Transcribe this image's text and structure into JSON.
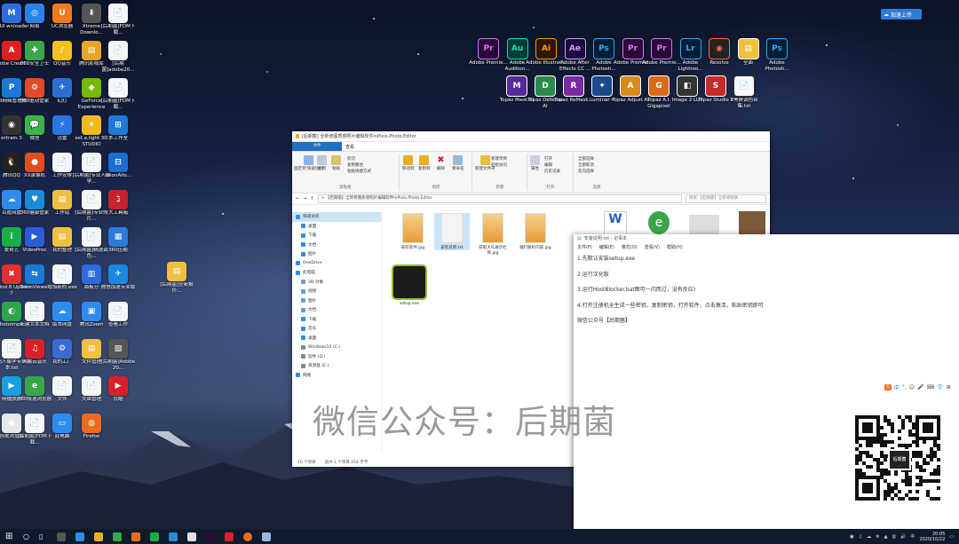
{
  "desktop": {
    "cloud_button": "加速上传",
    "left_icons": [
      {
        "label": "MIUI wnloader",
        "color": "#2d6cdf",
        "glyph": "M"
      },
      {
        "label": "网易",
        "color": "#2b82e6",
        "glyph": "◎"
      },
      {
        "label": "UC浏览器",
        "color": "#f07a1e",
        "glyph": "U"
      },
      {
        "label": "Xtreme Downlo...",
        "color": "#555",
        "glyph": "⬇"
      },
      {
        "label": "[后期菌]FDM下载...",
        "color": "#f6f6f6",
        "glyph": "📄"
      },
      {
        "label": "Adobe Creati...",
        "color": "#e02020",
        "glyph": "A"
      },
      {
        "label": "360安全卫士",
        "color": "#3aa64a",
        "glyph": "✚"
      },
      {
        "label": "QQ音乐",
        "color": "#f3c21c",
        "glyph": "♪"
      },
      {
        "label": "腾讯影视库",
        "color": "#e8a52a",
        "glyph": "▤"
      },
      {
        "label": "[后期菌]adobe20...",
        "color": "#f6f6f6",
        "glyph": "📄"
      },
      {
        "label": "ad网络管理器",
        "color": "#1a78d6",
        "glyph": "P"
      },
      {
        "label": "360驱动管家",
        "color": "#e24a2a",
        "glyph": "⚙"
      },
      {
        "label": "幻灯",
        "color": "#2b6fd0",
        "glyph": "✈"
      },
      {
        "label": "GeForce Experience",
        "color": "#76b900",
        "glyph": "◆"
      },
      {
        "label": "[后期菌]FDM下载...",
        "color": "#f6f6f6",
        "glyph": "📄"
      },
      {
        "label": "ertrain 3",
        "color": "#333",
        "glyph": "◉"
      },
      {
        "label": "微信",
        "color": "#3bb54a",
        "glyph": "💬"
      },
      {
        "label": "迅雷",
        "color": "#2a76e0",
        "glyph": "⚡"
      },
      {
        "label": "set.a.light 3D STUDIO",
        "color": "#f0b820",
        "glyph": "☀"
      },
      {
        "label": "本工作室",
        "color": "#1e7ad8",
        "glyph": "⊞"
      },
      {
        "label": "腾讯QQ",
        "color": "#222",
        "glyph": "🐧"
      },
      {
        "label": "XX录像机",
        "color": "#e34d1e",
        "glyph": "●"
      },
      {
        "label": "工作安排",
        "color": "#f6f6f6",
        "glyph": "📄"
      },
      {
        "label": "[后期菌]专业人像学...",
        "color": "#f6f6f6",
        "glyph": "📄"
      },
      {
        "label": "ssionAllo...",
        "color": "#1a6fd0",
        "glyph": "⊟"
      },
      {
        "label": "百度网盘",
        "color": "#2d8cf0",
        "glyph": "☁"
      },
      {
        "label": "360健康管家",
        "color": "#1a8ad8",
        "glyph": "♥"
      },
      {
        "label": "工作站",
        "color": "#f0c040",
        "glyph": "▤"
      },
      {
        "label": "[后期菌]专业照片...",
        "color": "#f6f6f6",
        "glyph": "📄"
      },
      {
        "label": "大工具箱",
        "color": "#c8232c",
        "glyph": "ℷ"
      },
      {
        "label": "爱奇艺",
        "color": "#18b046",
        "glyph": "i"
      },
      {
        "label": "VideoProc",
        "color": "#2d5bd8",
        "glyph": "▶"
      },
      {
        "label": "我的整理",
        "color": "#f0c040",
        "glyph": "▤"
      },
      {
        "label": "[后期菌]精选调色...",
        "color": "#f6f6f6",
        "glyph": "📄"
      },
      {
        "label": "360压缩",
        "color": "#2d7ad8",
        "glyph": "▦"
      },
      {
        "label": "XMind 8 Update 7",
        "color": "#e03030",
        "glyph": "✖"
      },
      {
        "label": "TeamViewer",
        "color": "#1e78d6",
        "glyph": "⇆"
      },
      {
        "label": "增加新的.exe",
        "color": "#f6f6f6",
        "glyph": "📄"
      },
      {
        "label": "面板分",
        "color": "#2d6cdf",
        "glyph": "▥"
      },
      {
        "label": "微信加速专业版",
        "color": "#1a88e0",
        "glyph": "✈"
      },
      {
        "label": "PhotoImpr...",
        "color": "#2aa84a",
        "glyph": "◐"
      },
      {
        "label": "新建文本文档",
        "color": "#f6f6f6",
        "glyph": "📄"
      },
      {
        "label": "版本网盘",
        "color": "#2d8cf0",
        "glyph": "☁"
      },
      {
        "label": "腾讯Zoom",
        "color": "#2d8cf0",
        "glyph": "▣"
      },
      {
        "label": "查看工作",
        "color": "#f6f6f6",
        "glyph": "📄"
      },
      {
        "label": "三码人像学专业版本.txt",
        "color": "#f6f6f6",
        "glyph": "📄"
      },
      {
        "label": "网易云音乐",
        "color": "#d8202a",
        "glyph": "♫"
      },
      {
        "label": "我的工厂",
        "color": "#3a6ad0",
        "glyph": "⚙"
      },
      {
        "label": "文件管理",
        "color": "#f0c040",
        "glyph": "▤"
      },
      {
        "label": "[后期菌]Adobe 20...",
        "color": "#555",
        "glyph": "▧"
      },
      {
        "label": "频播放器",
        "color": "#18a0e0",
        "glyph": "▶"
      },
      {
        "label": "360极速浏览器",
        "color": "#3aa64a",
        "glyph": "e"
      },
      {
        "label": "文件",
        "color": "#f6f6f6",
        "glyph": "📄"
      },
      {
        "label": "文章管理",
        "color": "#f6f6f6",
        "glyph": "📄"
      },
      {
        "label": "优酷",
        "color": "#d8202a",
        "glyph": "▶"
      },
      {
        "label": "谷歌浏览器",
        "color": "#e8e8e8",
        "glyph": "◉"
      },
      {
        "label": "[后期菌]FDM下载...",
        "color": "#f6f6f6",
        "glyph": "📄"
      },
      {
        "label": "此电脑",
        "color": "#2d8cf0",
        "glyph": "▭"
      },
      {
        "label": "Firefox",
        "color": "#f06a1e",
        "glyph": "◍"
      }
    ],
    "mid_icon": {
      "label": "[后期菌]全新报价...",
      "color": "#f0c040"
    },
    "right_icons_row1": [
      {
        "label": "Adobe Premie...",
        "color": "#2a0a3a",
        "accent": "#e070ff",
        "glyph": "Pr"
      },
      {
        "label": "Adobe Audition...",
        "color": "#063b36",
        "accent": "#00e4bb",
        "glyph": "Au"
      },
      {
        "label": "Adobe Illustrat...",
        "color": "#2f1600",
        "accent": "#ff9a00",
        "glyph": "Ai"
      },
      {
        "label": "Adobe After Effects CC ...",
        "color": "#1c0a3e",
        "accent": "#c9a0ff",
        "glyph": "Ae"
      },
      {
        "label": "Adobe Photosh...",
        "color": "#021e36",
        "accent": "#31a8ff",
        "glyph": "Ps"
      },
      {
        "label": "Adobe Premie...",
        "color": "#2a0a3a",
        "accent": "#e070ff",
        "glyph": "Pr"
      },
      {
        "label": "Adobe Premie...",
        "color": "#2a0a3a",
        "accent": "#e070ff",
        "glyph": "Pr"
      },
      {
        "label": "Adobe Lightroo...",
        "color": "#001e36",
        "accent": "#31a8ff",
        "glyph": "Lr"
      },
      {
        "label": "Resolve",
        "color": "#222",
        "accent": "#ff7040",
        "glyph": "◉"
      },
      {
        "label": "全面",
        "color": "#f0c040",
        "accent": "#fff",
        "glyph": "▤"
      },
      {
        "label": "Adobe Photosh...",
        "color": "#021e36",
        "accent": "#31a8ff",
        "glyph": "Ps"
      }
    ],
    "right_icons_row2": [
      {
        "label": "Topaz Mask AI",
        "color": "#5a2a9a",
        "accent": "#fff",
        "glyph": "M"
      },
      {
        "label": "Topaz DeNoise AI",
        "color": "#2a8a4a",
        "accent": "#fff",
        "glyph": "D"
      },
      {
        "label": "Topaz ReMask...",
        "color": "#7a2aa0",
        "accent": "#fff",
        "glyph": "R"
      },
      {
        "label": "Luminar 4",
        "color": "#1a4a8a",
        "accent": "#fff",
        "glyph": "✦"
      },
      {
        "label": "Topaz Adjust AI",
        "color": "#d88a1a",
        "accent": "#fff",
        "glyph": "A"
      },
      {
        "label": "Topaz A.I. Gigapixel",
        "color": "#d86a1a",
        "accent": "#fff",
        "glyph": "G"
      },
      {
        "label": "Image 2 LUT",
        "color": "#333",
        "accent": "#fff",
        "glyph": "◧"
      },
      {
        "label": "Topaz Studio 2",
        "color": "#c82a2a",
        "accent": "#fff",
        "glyph": "S"
      },
      {
        "label": "V黑屏调色合集.txt",
        "color": "#f6f6f6",
        "accent": "#333",
        "glyph": "📄"
      }
    ]
  },
  "explorer": {
    "title": "[后期菌] 全新修图质感照片编辑软件InPixio.Photo.Editor",
    "tabs": [
      "文件",
      "主页",
      "共享",
      "查看"
    ],
    "ribbon": {
      "pin": "固定到'快速访问'",
      "copy": "复制",
      "paste": "粘贴",
      "cut": "剪切",
      "copy_path": "复制路径",
      "paste_shortcut": "粘贴快捷方式",
      "move_to": "移动到",
      "copy_to": "复制到",
      "delete": "删除",
      "rename": "重命名",
      "new_folder": "新建文件夹",
      "new_item": "新建项目",
      "easy_access": "轻松访问",
      "properties": "属性",
      "open": "打开",
      "edit": "编辑",
      "history": "历史记录",
      "select_all": "全部选择",
      "select_none": "全部取消",
      "invert": "反向选择",
      "groups": [
        "剪贴板",
        "组织",
        "新建",
        "打开",
        "选择"
      ]
    },
    "address": "> 【后期菌】全新修图质感照片编辑软件InPixio.Photo.Editor",
    "search_placeholder": "搜索'【后期菌】全新修图质...",
    "nav": [
      "快速访问",
      "桌面",
      "下载",
      "文档",
      "图片",
      "OneDrive",
      "此电脑",
      "3D 对象",
      "视频",
      "图片",
      "文档",
      "下载",
      "音乐",
      "桌面",
      "Windows10 (C:)",
      "软件 (D:)",
      "资源盘 (E:)",
      "网络"
    ],
    "files": [
      {
        "name": "安装软件.jpg",
        "kind": "img"
      },
      {
        "name": "安装说明.txt",
        "kind": "txt"
      },
      {
        "name": "获取大礼展示栏目.jpg",
        "kind": "img"
      },
      {
        "name": "趣打解析内容.jpg",
        "kind": "img"
      },
      {
        "name": "setup.exe",
        "kind": "exe"
      }
    ],
    "status": [
      "10 个项目",
      "选中 1 个项目  254 字节"
    ]
  },
  "notepad": {
    "title": "安装说明.txt - 记事本",
    "menu": [
      "文件(F)",
      "编辑(E)",
      "格式(O)",
      "查看(V)",
      "帮助(H)"
    ],
    "lines": [
      "1.先默认安装setup.exe",
      "2.运行汉化版",
      "3.运行HostBlocker.bat图可一闪而过，没有反应)",
      "4.打开注册机全生成一些密钥，复制密钥，打开软件，点击激活，粘贴密钥即可",
      "微信公众号【后期菌】"
    ],
    "qr_label": "后期菌"
  },
  "watermark": "微信公众号：后期菌",
  "ime_label": "中",
  "taskbar": {
    "time": "20:05",
    "date": "2020/10/22"
  }
}
